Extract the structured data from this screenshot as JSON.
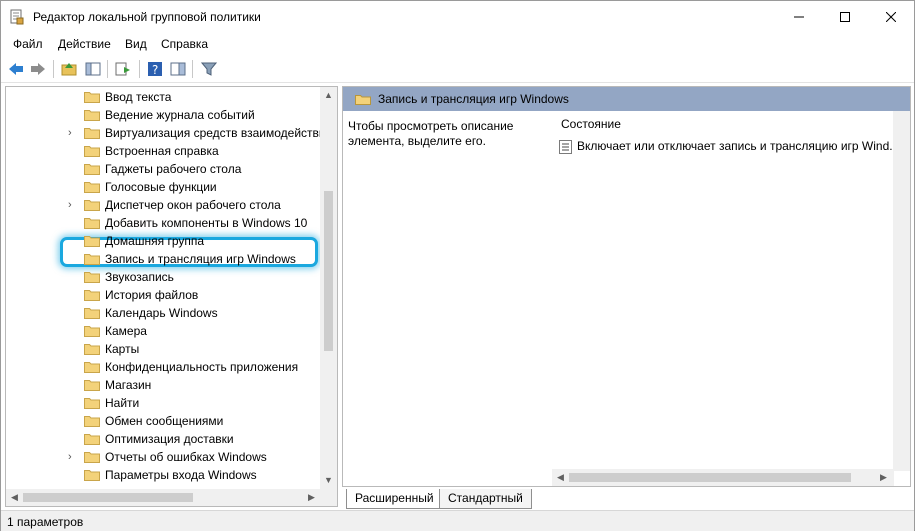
{
  "window": {
    "title": "Редактор локальной групповой политики",
    "icon": "document-policy-icon"
  },
  "menu": {
    "items": [
      "Файл",
      "Действие",
      "Вид",
      "Справка"
    ]
  },
  "toolbar": {
    "icons": [
      "back-arrow-icon",
      "forward-arrow-icon",
      "up-folder-icon",
      "show-hide-tree-icon",
      "export-list-icon",
      "help-icon",
      "properties-pane-icon",
      "filter-icon"
    ]
  },
  "tree": {
    "items": [
      {
        "label": "Ввод текста",
        "expandable": false
      },
      {
        "label": "Ведение журнала событий",
        "expandable": false
      },
      {
        "label": "Виртуализация средств взаимодействи",
        "expandable": true
      },
      {
        "label": "Встроенная справка",
        "expandable": false
      },
      {
        "label": "Гаджеты рабочего стола",
        "expandable": false
      },
      {
        "label": "Голосовые функции",
        "expandable": false
      },
      {
        "label": "Диспетчер окон рабочего стола",
        "expandable": true
      },
      {
        "label": "Добавить компоненты в Windows 10",
        "expandable": false
      },
      {
        "label": "Домашняя группа",
        "expandable": false
      },
      {
        "label": "Запись и трансляция игр Windows",
        "expandable": false,
        "selected": true
      },
      {
        "label": "Звукозапись",
        "expandable": false
      },
      {
        "label": "История файлов",
        "expandable": false
      },
      {
        "label": "Календарь Windows",
        "expandable": false
      },
      {
        "label": "Камера",
        "expandable": false
      },
      {
        "label": "Карты",
        "expandable": false
      },
      {
        "label": "Конфиденциальность приложения",
        "expandable": false
      },
      {
        "label": "Магазин",
        "expandable": false
      },
      {
        "label": "Найти",
        "expandable": false
      },
      {
        "label": "Обмен сообщениями",
        "expandable": false
      },
      {
        "label": "Оптимизация доставки",
        "expandable": false
      },
      {
        "label": "Отчеты об ошибках Windows",
        "expandable": true
      },
      {
        "label": "Параметры входа Windows",
        "expandable": false
      }
    ]
  },
  "right": {
    "header": "Запись и трансляция игр Windows",
    "description": "Чтобы просмотреть описание элемента, выделите его.",
    "column_header": "Состояние",
    "settings": [
      "Включает или отключает запись и трансляцию игр Wind..."
    ]
  },
  "tabs": [
    "Расширенный",
    "Стандартный"
  ],
  "status": {
    "text": "1 параметров"
  },
  "colors": {
    "highlight_border": "#1aa8df",
    "header_band": "#93a6c4",
    "folder_yellow": "#f3d27a"
  }
}
